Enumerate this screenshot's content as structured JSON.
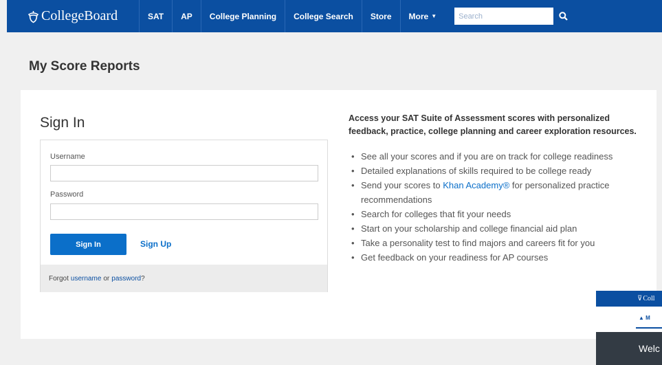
{
  "nav": {
    "logo": "CollegeBoard",
    "items": [
      "SAT",
      "AP",
      "College Planning",
      "College Search",
      "Store",
      "More"
    ],
    "search_placeholder": "Search"
  },
  "page_title": "My Score Reports",
  "signin": {
    "title": "Sign In",
    "username_label": "Username",
    "password_label": "Password",
    "signin_button": "Sign In",
    "signup_link": "Sign Up",
    "forgot_prefix": "Forgot",
    "forgot_username": "username",
    "forgot_or": "or",
    "forgot_password": "password",
    "forgot_suffix": "?"
  },
  "info": {
    "heading": "Access your SAT Suite of Assessment scores with personalized feedback, practice, college planning and career exploration resources.",
    "bullet1": "See all your scores and if you are on track for college readiness",
    "bullet2": "Detailed explanations of skills required to be college ready",
    "bullet3_prefix": "Send your scores to",
    "bullet3_link": "Khan Academy®",
    "bullet3_suffix": "for personalized practice recommendations",
    "bullet4": "Search for colleges that fit your needs",
    "bullet5": "Start on your scholarship and college financial aid plan",
    "bullet6": "Take a personality test to find majors and careers fit for you",
    "bullet7": "Get feedback on your readiness for AP courses"
  },
  "overlay": {
    "logo": "Coll",
    "tab": "M",
    "welcome": "Welc"
  },
  "colors": {
    "navbar": "#0b4fa1",
    "button": "#0b6fc9",
    "link": "#0b6fc9"
  }
}
